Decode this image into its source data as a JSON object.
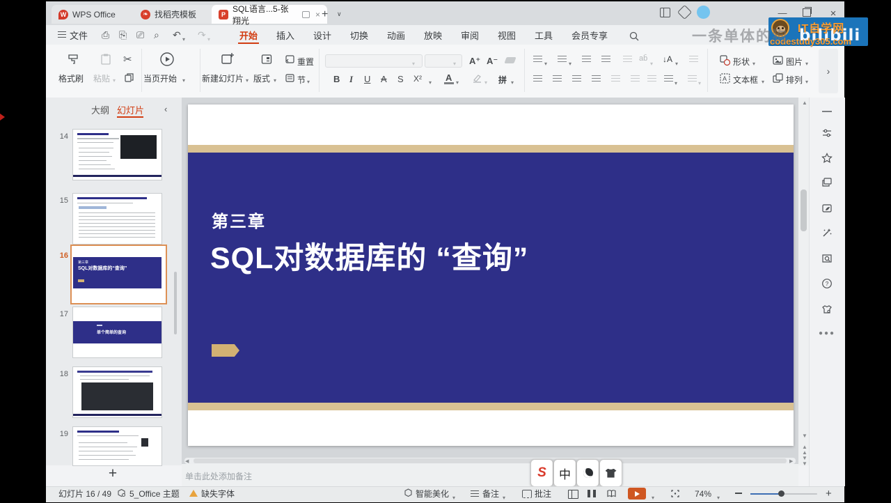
{
  "tabs": {
    "home": "WPS Office",
    "docer": "找稻壳模板",
    "doc": "SQL语言...5-张翔光"
  },
  "menubar": {
    "file": "文件",
    "items": [
      "开始",
      "插入",
      "设计",
      "切换",
      "动画",
      "放映",
      "审阅",
      "视图",
      "工具",
      "会员专享"
    ]
  },
  "ribbon": {
    "format_painter": "格式刷",
    "paste": "粘贴",
    "play_from_current": "当页开始",
    "new_slide": "新建幻灯片",
    "layout": "版式",
    "reset": "重置",
    "section": "节",
    "bold": "B",
    "italic": "I",
    "underline": "U",
    "strike_a": "A",
    "shadow_s": "S",
    "superscript": "X²",
    "font_color": "A",
    "phonetic": "拼",
    "shapes": "形状",
    "picture": "图片",
    "text_box": "文本框",
    "arrange": "排列"
  },
  "sidebar": {
    "outline_tab": "大纲",
    "slides_tab": "幻灯片",
    "slide_numbers": [
      "14",
      "15",
      "16",
      "17",
      "18",
      "19"
    ],
    "add_slide": "+"
  },
  "slide": {
    "chapter": "第三章",
    "title": "SQL对数据库的 “查询”"
  },
  "thumbs": {
    "t16_chapter": "第三章",
    "t16_title": "SQL对数据库的“查询”",
    "t17_title": "单个简单的查询"
  },
  "notes": {
    "placeholder": "单击此处添加备注"
  },
  "statusbar": {
    "slide_counter": "幻灯片 16 / 49",
    "theme": "5_Office 主题",
    "missing_font": "缺失字体",
    "beautify": "智能美化",
    "notes_label": "备注",
    "comments_label": "批注",
    "zoom_level": "74%"
  },
  "ime": {
    "logo": "S",
    "lang": "中"
  },
  "overlay": {
    "watermark": "一条单体的狗",
    "brand": "IT自学网",
    "url": "codestudy305.com",
    "bilibili": "bilibili"
  },
  "colors": {
    "accent_orange": "#d23d12",
    "slide_blue": "#2e2f88",
    "tan_bar": "#d9c193",
    "overlay_blue": "#1b74ba"
  }
}
